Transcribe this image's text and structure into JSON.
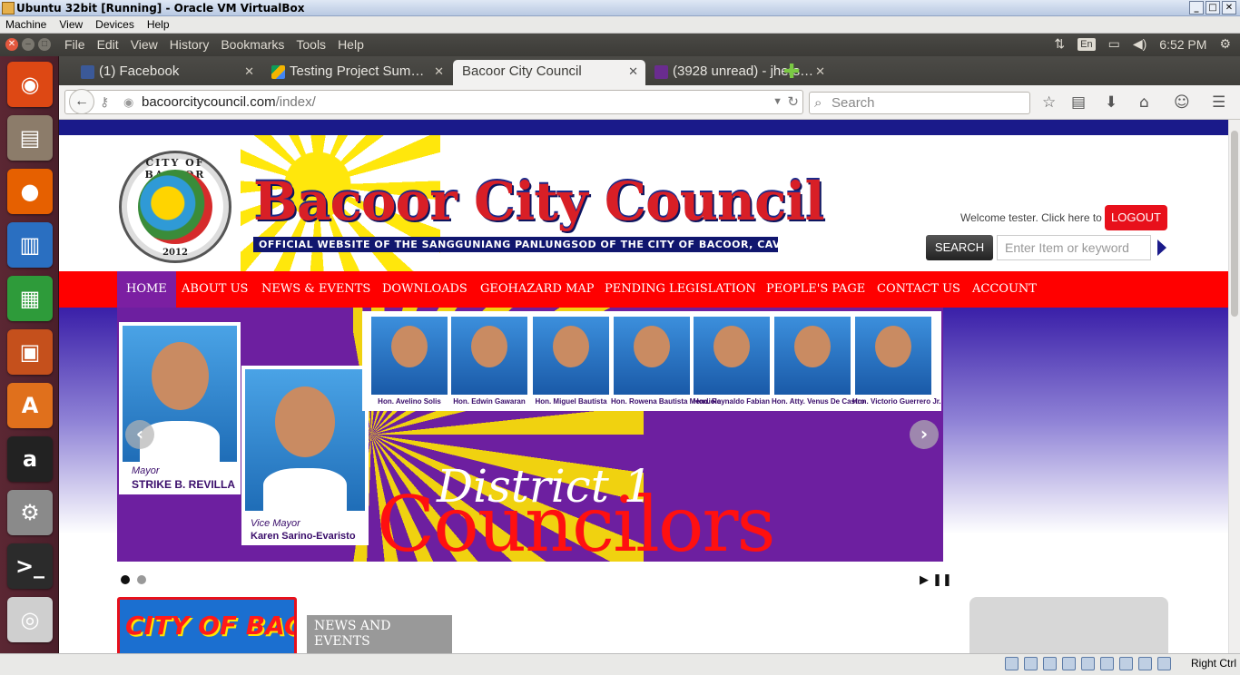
{
  "vbox": {
    "title": "Ubuntu 32bit [Running] - Oracle VM VirtualBox",
    "menu": [
      "Machine",
      "View",
      "Devices",
      "Help"
    ],
    "status_host_key": "Right Ctrl"
  },
  "ubuntu_panel": {
    "menus": [
      "File",
      "Edit",
      "View",
      "History",
      "Bookmarks",
      "Tools",
      "Help"
    ],
    "keyboard": "En",
    "clock": "6:52 PM"
  },
  "launcher": [
    {
      "name": "ubuntu-dash-icon",
      "glyph": "◉",
      "color": "#dd4814"
    },
    {
      "name": "files-icon",
      "glyph": "▤",
      "color": "#8c7c6a"
    },
    {
      "name": "firefox-icon",
      "glyph": "●",
      "color": "#e66000"
    },
    {
      "name": "writer-icon",
      "glyph": "▥",
      "color": "#2a6fc1"
    },
    {
      "name": "calc-icon",
      "glyph": "▦",
      "color": "#2e9b3a"
    },
    {
      "name": "impress-icon",
      "glyph": "▣",
      "color": "#c5501c"
    },
    {
      "name": "software-center-icon",
      "glyph": "A",
      "color": "#e0701c"
    },
    {
      "name": "amazon-icon",
      "glyph": "a",
      "color": "#222222"
    },
    {
      "name": "system-settings-icon",
      "glyph": "⚙",
      "color": "#8a8a8a"
    },
    {
      "name": "terminal-icon",
      "glyph": ">_",
      "color": "#2b2b2b"
    },
    {
      "name": "dvd-icon",
      "glyph": "◎",
      "color": "#cfcfcf"
    }
  ],
  "tabs": [
    {
      "label": "(1) Facebook",
      "icon": "facebook-icon",
      "color": "#3b5998"
    },
    {
      "label": "Testing Project Sum…",
      "icon": "drive-icon",
      "color": "#f4b400"
    },
    {
      "label": "Bacoor City Council",
      "icon": "",
      "color": ""
    },
    {
      "label": "(3928 unread) - jhers…",
      "icon": "mail-icon",
      "color": "#6a2c8f"
    }
  ],
  "navbar": {
    "url_host": "bacoorcitycouncil.com",
    "url_path": "/index/",
    "search_placeholder": "Search"
  },
  "site": {
    "seal_top": "CITY OF BACOOR",
    "seal_year": "2012",
    "title": "Bacoor City Council",
    "subtitle": "OFFICIAL WEBSITE OF THE SANGGUNIANG PANLUNGSOD OF THE CITY OF BACOOR, CAVITE",
    "welcome": "Welcome tester. Click here to",
    "logout": "LOGOUT",
    "search_button": "SEARCH",
    "search_placeholder": "Enter Item or keyword",
    "nav": [
      "HOME",
      "ABOUT US",
      "NEWS & EVENTS",
      "DOWNLOADS",
      "GEOHAZARD MAP",
      "PENDING LEGISLATION",
      "PEOPLE'S PAGE",
      "CONTACT US",
      "ACCOUNT"
    ],
    "slide": {
      "mayor_role": "Mayor",
      "mayor_name": "STRIKE B. REVILLA",
      "vice_role": "Vice Mayor",
      "vice_name": "Karen Sarino-Evaristo",
      "councilors": [
        "Hon. Avelino Solis",
        "Hon. Edwin Gawaran",
        "Hon. Miguel Bautista",
        "Hon. Rowena Bautista Mendiola",
        "Hon. Reynaldo Fabian",
        "Hon. Atty. Venus De Castro",
        "Hon. Victorio Guerrero Jr."
      ],
      "district": "District 1",
      "councilors_word": "Councilors"
    },
    "city_banner": "CITY OF BACOOR",
    "news_heading": "NEWS AND EVENTS"
  }
}
